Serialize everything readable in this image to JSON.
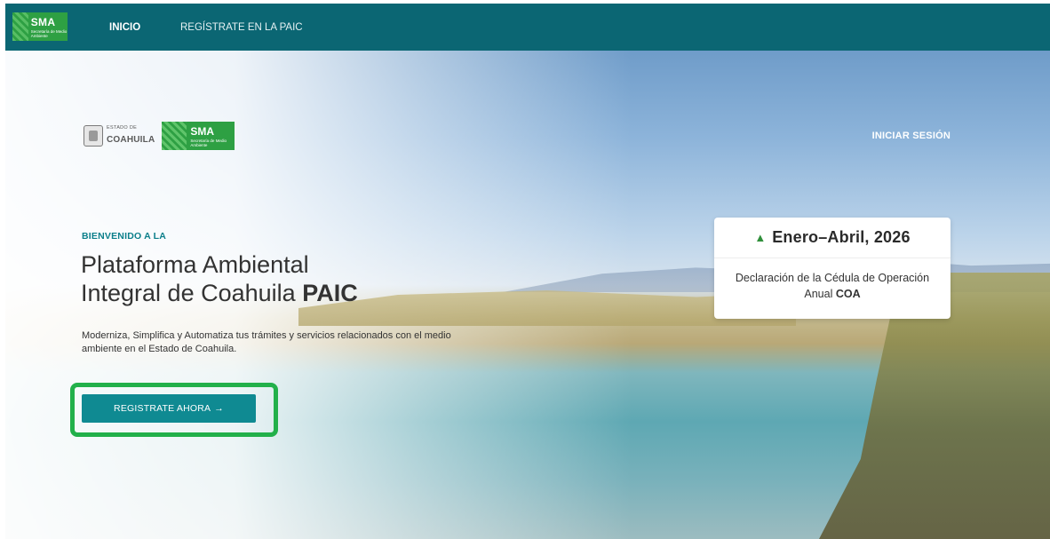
{
  "navbar": {
    "logo": {
      "big": "SMA",
      "small": "Secretaría de Medio Ambiente"
    },
    "items": [
      {
        "label": "INICIO",
        "active": true
      },
      {
        "label": "REGÍSTRATE EN LA PAIC",
        "active": false
      }
    ],
    "bg_color": "#0b6673"
  },
  "hero": {
    "state_logo": {
      "small": "ESTADO DE",
      "big": "COAHUILA"
    },
    "sma_logo": {
      "big": "SMA",
      "small": "Secretaría de Medio Ambiente"
    },
    "login_label": "INICIAR SESIÓN",
    "welcome": "BIENVENIDO A LA",
    "title_line1": "Plataforma Ambiental",
    "title_line2": "Integral de Coahuila",
    "title_strong": "PAIC",
    "description": "Moderniza, Simplifica y Automatiza tus trámites y servicios relacionados con el medio ambiente en el Estado de Coahuila.",
    "cta_label": "REGISTRATE AHORA",
    "cta_color": "#0f8a92",
    "highlight_color": "#22b04a"
  },
  "announcement": {
    "icon": "bell-icon",
    "period": "Enero–Abril, 2026",
    "text": "Declaración de la Cédula de Operación Anual",
    "text_strong": "COA"
  }
}
